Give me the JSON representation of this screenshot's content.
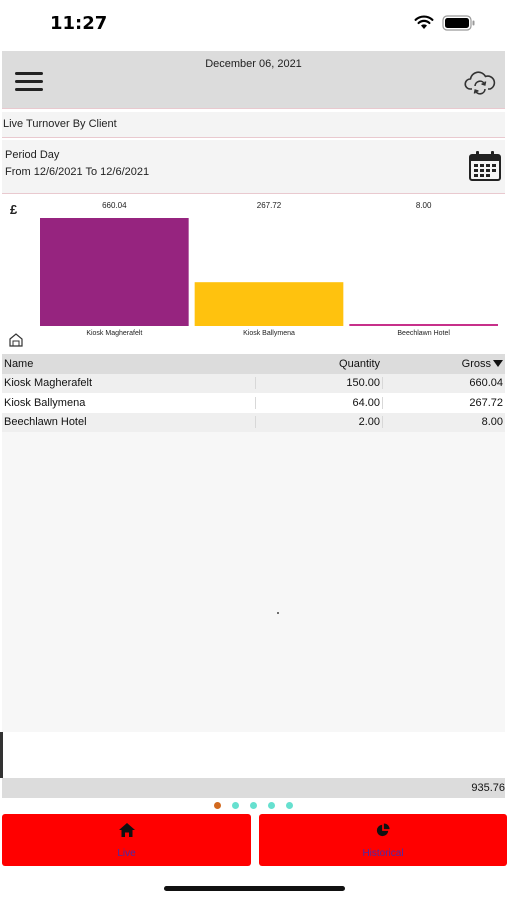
{
  "status_bar": {
    "time": "11:27"
  },
  "header": {
    "date": "December 06, 2021"
  },
  "section": {
    "title": "Live Turnover By Client"
  },
  "period": {
    "label": "Period Day",
    "range": "From 12/6/2021 To 12/6/2021"
  },
  "chart_data": {
    "type": "bar",
    "currency_symbol": "£",
    "categories": [
      "Kiosk Magherafelt",
      "Kiosk Ballymena",
      "Beechlawn Hotel"
    ],
    "values": [
      660.04,
      267.72,
      8.0
    ],
    "value_labels": [
      "660.04",
      "267.72",
      "8.00"
    ],
    "colors": [
      "#96247f",
      "#ffc20e",
      "#c7308a"
    ],
    "ylim": [
      0,
      660.04
    ],
    "title": "",
    "xlabel": "",
    "ylabel": ""
  },
  "table": {
    "columns": {
      "name": "Name",
      "quantity": "Quantity",
      "gross": "Gross"
    },
    "rows": [
      {
        "name": "Kiosk Magherafelt",
        "quantity": "150.00",
        "gross": "660.04"
      },
      {
        "name": "Kiosk Ballymena",
        "quantity": "64.00",
        "gross": "267.72"
      },
      {
        "name": "Beechlawn Hotel",
        "quantity": "2.00",
        "gross": "8.00"
      }
    ]
  },
  "total": {
    "gross": "935.76"
  },
  "pager": {
    "count": 5,
    "active_index": 0,
    "active_color": "#d2691e",
    "inactive_color": "#66e0cf"
  },
  "tabs": [
    {
      "label": "Live",
      "icon": "home-icon"
    },
    {
      "label": "Historical",
      "icon": "pie-chart-icon"
    }
  ]
}
